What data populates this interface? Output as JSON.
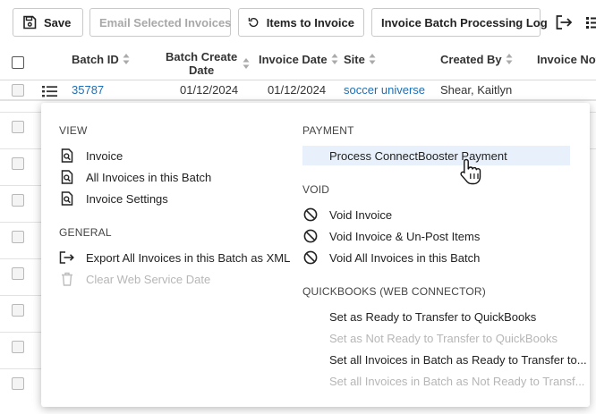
{
  "toolbar": {
    "save_label": "Save",
    "email_label": "Email Selected Invoices",
    "items_label": "Items to Invoice",
    "log_label": "Invoice Batch Processing Log"
  },
  "table": {
    "headers": {
      "batch_id": "Batch ID",
      "batch_create_1": "Batch Create",
      "batch_create_2": "Date",
      "invoice_date": "Invoice Date",
      "site": "Site",
      "created_by": "Created By",
      "invoice_notes": "Invoice Note"
    },
    "first_row": {
      "batch_id": "35787",
      "batch_create_date": "01/12/2024",
      "invoice_date": "01/12/2024",
      "site": "soccer universe",
      "created_by": "Shear, Kaitlyn"
    }
  },
  "menu": {
    "view": {
      "title": "VIEW",
      "items": [
        "Invoice",
        "All Invoices in this Batch",
        "Invoice Settings"
      ]
    },
    "general": {
      "title": "GENERAL",
      "items": [
        "Export All Invoices in this Batch as XML",
        "Clear Web Service Date"
      ]
    },
    "payment": {
      "title": "PAYMENT",
      "items": [
        "Process ConnectBooster Payment"
      ]
    },
    "void": {
      "title": "VOID",
      "items": [
        "Void Invoice",
        "Void Invoice & Un-Post Items",
        "Void All Invoices in this Batch"
      ]
    },
    "quickbooks": {
      "title": "QUICKBOOKS (WEB CONNECTOR)",
      "items": [
        "Set as Ready to Transfer to QuickBooks",
        "Set as Not Ready to Transfer to QuickBooks",
        "Set all Invoices in Batch as Ready to Transfer to...",
        "Set all Invoices in Batch as Not Ready to Transf..."
      ]
    }
  }
}
